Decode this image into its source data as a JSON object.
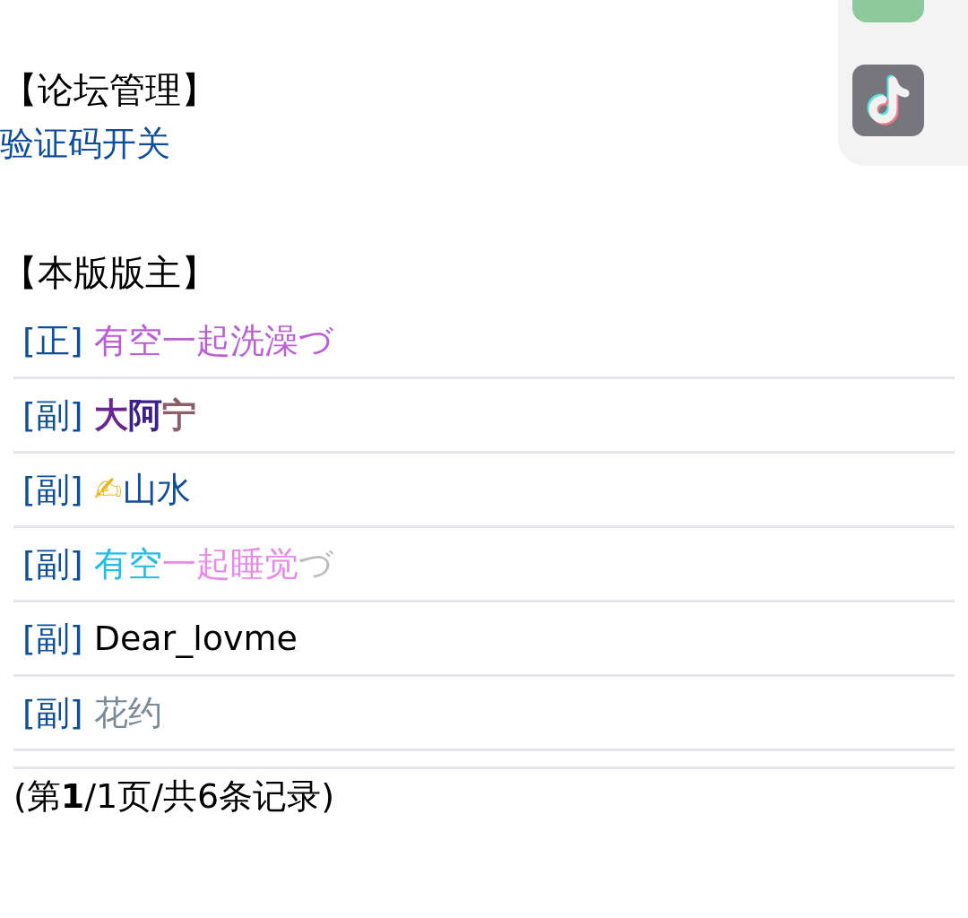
{
  "sections": [
    {
      "heading": "【论坛管理】",
      "links": [
        "验证码开关"
      ]
    },
    {
      "heading": "【本版版主】"
    }
  ],
  "moderators": [
    {
      "role": "[正]",
      "name": [
        {
          "text": "有空一起洗澡づ",
          "color": "#bb5fd6"
        }
      ],
      "bold": false
    },
    {
      "role": "[副]",
      "name": [
        {
          "text": "大",
          "color": "#6a2594"
        },
        {
          "text": "阿",
          "color": "#3c1e8c"
        },
        {
          "text": "宁",
          "color": "#8a5f6a"
        }
      ],
      "bold": true
    },
    {
      "role": "[副]",
      "name": [
        {
          "text": "✍",
          "color": "#e6b820"
        },
        {
          "text": "山水",
          "color": "#0d4f9c"
        }
      ],
      "bold": false
    },
    {
      "role": "[副]",
      "name": [
        {
          "text": "有空",
          "color": "#22bde6"
        },
        {
          "text": "一起睡觉",
          "color": "#e88ae8"
        },
        {
          "text": "づ",
          "color": "#bdbdbd"
        }
      ],
      "bold": false
    },
    {
      "role": "[副]",
      "name": [
        {
          "text": "Dear_lovme",
          "color": "#000000"
        }
      ],
      "bold": false
    },
    {
      "role": "[副]",
      "name": [
        {
          "text": "花约",
          "color": "#7a8a99"
        }
      ],
      "bold": false
    }
  ],
  "pagination": "(第**1**/1页/共6条记录)"
}
